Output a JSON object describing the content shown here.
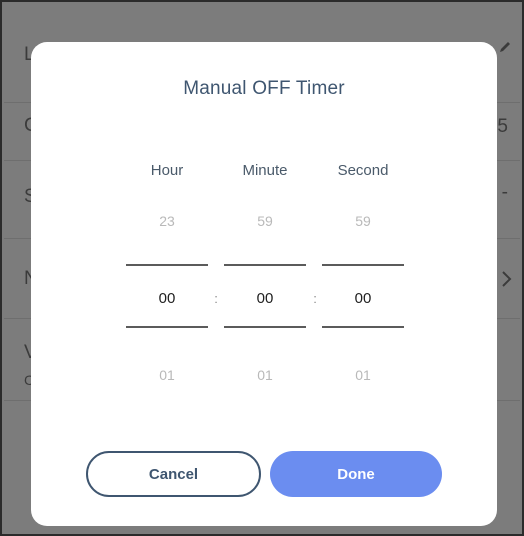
{
  "background": {
    "letters": [
      "L",
      "C",
      "S",
      "N",
      "V"
    ],
    "sub_letter": "C",
    "right_texts": [
      "5",
      "-"
    ],
    "icons": [
      "pencil-icon",
      "chevron-right-icon"
    ]
  },
  "dialog": {
    "title": "Manual OFF Timer",
    "columns": [
      {
        "header": "Hour",
        "prev": "23",
        "current": "00",
        "next": "01"
      },
      {
        "header": "Minute",
        "prev": "59",
        "current": "00",
        "next": "01"
      },
      {
        "header": "Second",
        "prev": "59",
        "current": "00",
        "next": "01"
      }
    ],
    "separator": ":",
    "cancel_label": "Cancel",
    "done_label": "Done"
  },
  "colors": {
    "title": "#3f5670",
    "cancel_border": "#3f5670",
    "done_background": "#6b8df0",
    "done_text": "#ffffff",
    "overlay": "#7c7c7c"
  }
}
